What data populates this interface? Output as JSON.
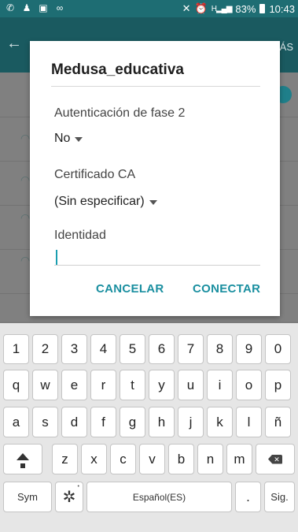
{
  "status_bar": {
    "left_icons": [
      "whatsapp-icon",
      "person-icon",
      "image-icon",
      "link-icon"
    ],
    "battery": "83%",
    "time": "10:43",
    "signal_label": "H"
  },
  "background": {
    "right_text": "ÁS"
  },
  "dialog": {
    "title": "Medusa_educativa",
    "phase2_label": "Autenticación de fase 2",
    "phase2_value": "No",
    "ca_label": "Certificado CA",
    "ca_value": "(Sin especificar)",
    "identity_label": "Identidad",
    "identity_value": "",
    "cancel_label": "CANCELAR",
    "connect_label": "CONECTAR"
  },
  "keyboard": {
    "row1": [
      "1",
      "2",
      "3",
      "4",
      "5",
      "6",
      "7",
      "8",
      "9",
      "0"
    ],
    "row2": [
      "q",
      "w",
      "e",
      "r",
      "t",
      "y",
      "u",
      "i",
      "o",
      "p"
    ],
    "row3": [
      "a",
      "s",
      "d",
      "f",
      "g",
      "h",
      "j",
      "k",
      "l",
      "ñ"
    ],
    "row4": [
      "z",
      "x",
      "c",
      "v",
      "b",
      "n",
      "m"
    ],
    "sym_label": "Sym",
    "space_label": "Español(ES)",
    "period_label": ".",
    "next_label": "Sig."
  }
}
